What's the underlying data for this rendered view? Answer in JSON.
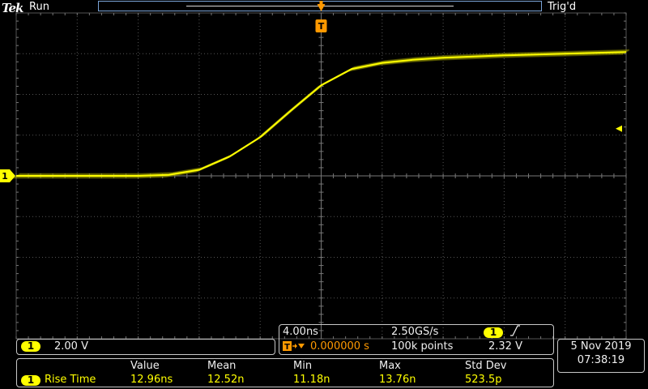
{
  "top_bar": {
    "brand": "Tek",
    "run_state": "Run",
    "trigger_state": "Trig'd"
  },
  "markers": {
    "channel_marker": "1",
    "trigger_marker": "T"
  },
  "channel": {
    "number": "1",
    "vertical_scale": "2.00 V"
  },
  "horizontal": {
    "time_per_div": "4.00ns",
    "sample_rate": "2.50GS/s",
    "trigger_channel": "1",
    "trigger_slope_icon": "rising-edge-icon",
    "trigger_position_icon": "T",
    "trigger_position": "0.000000 s",
    "record_length": "100k points",
    "trigger_level": "2.32 V"
  },
  "datetime": {
    "date": "5 Nov 2019",
    "time": "07:38:19"
  },
  "measurements": {
    "headers": [
      "Value",
      "Mean",
      "Min",
      "Max",
      "Std Dev"
    ],
    "rows": [
      {
        "channel": "1",
        "name": "Rise Time",
        "value": "12.96ns",
        "mean": "12.52n",
        "min": "11.18n",
        "max": "13.76n",
        "std_dev": "523.5p"
      }
    ]
  },
  "colors": {
    "trace": "#ffff00",
    "trigger": "#ff9900",
    "graticule": "#555555",
    "record_bar": "#7aa3d6"
  },
  "chart_data": {
    "type": "line",
    "series": [
      {
        "x": [
          -20,
          -18,
          -16,
          -12,
          -10,
          -8,
          -6,
          -4,
          -2,
          0,
          2,
          4,
          6,
          8,
          12,
          16,
          20
        ],
        "y": [
          -0.0,
          -0.0,
          -0.0,
          -0.0,
          0.05,
          0.3,
          0.95,
          1.9,
          3.2,
          4.45,
          5.25,
          5.55,
          5.7,
          5.8,
          5.92,
          6.0,
          6.08
        ]
      }
    ],
    "xlim": [
      -20,
      20
    ],
    "ylim": [
      -8,
      8
    ],
    "x_units": "ns",
    "y_units": "V",
    "grid": true
  }
}
